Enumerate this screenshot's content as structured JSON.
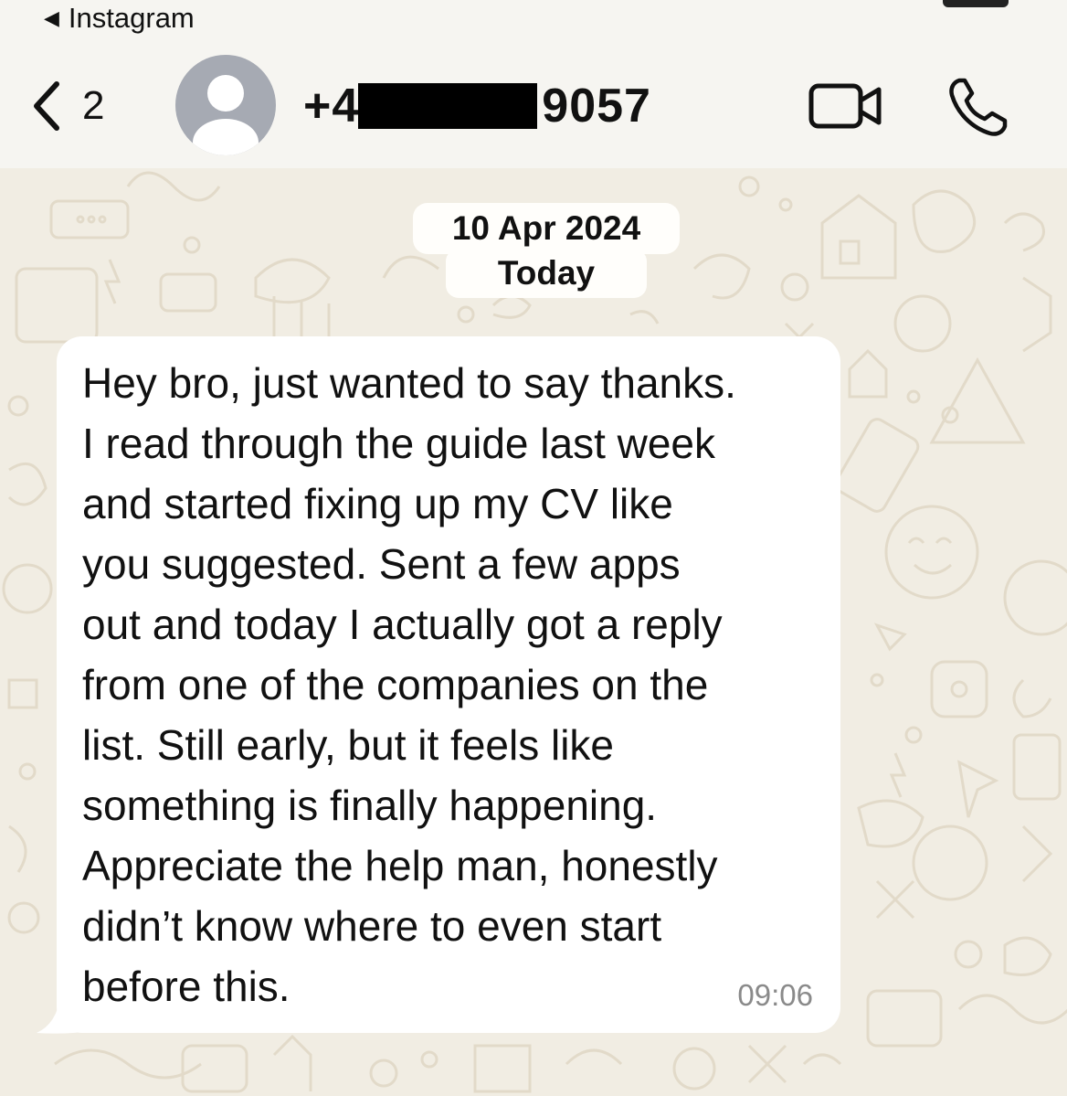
{
  "status_bar": {
    "back_app_label": "Instagram"
  },
  "header": {
    "back_count": "2",
    "contact_prefix": "+4",
    "contact_suffix": "9057",
    "icons": [
      "chevron-left-icon",
      "avatar-placeholder-icon",
      "video-call-icon",
      "phone-call-icon"
    ]
  },
  "chat": {
    "date_label": "10 Apr 2024",
    "day_label": "Today",
    "message": {
      "text": "Hey bro, just wanted to say thanks.\nI read through the guide last week\nand started fixing up my CV like\nyou suggested. Sent a few apps\nout and today I actually got a reply\nfrom one of the companies on the\nlist. Still early, but it feels like\nsomething is finally happening.\nAppreciate the help man, honestly\ndidn’t know where to even start\nbefore this.",
      "time": "09:06"
    }
  },
  "colors": {
    "chat_background": "#f1ede3",
    "header_background": "#f6f5f1",
    "bubble": "#ffffff",
    "timestamp": "#8a8a8a"
  }
}
